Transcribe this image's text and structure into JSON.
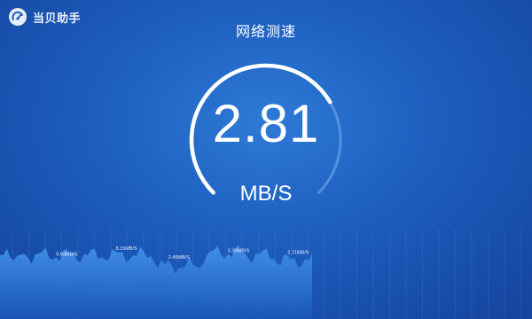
{
  "brand": {
    "name": "当贝助手",
    "icon": "speedometer-logo-icon"
  },
  "header": {
    "title": "网络测速"
  },
  "gauge": {
    "value": "2.81",
    "unit": "MB/S",
    "progress_fraction": 0.72
  },
  "history": {
    "labels": [
      {
        "text": "9.63MB/S",
        "index": 16
      },
      {
        "text": "8.15MB/S",
        "index": 33
      },
      {
        "text": "2.45MB/S",
        "index": 48
      },
      {
        "text": "5.36MB/S",
        "index": 65
      },
      {
        "text": "2.71MB/S",
        "index": 82
      }
    ]
  },
  "colors": {
    "accent": "#ffffff",
    "track": "#5f97e3",
    "wave": "#3a8ae6"
  }
}
